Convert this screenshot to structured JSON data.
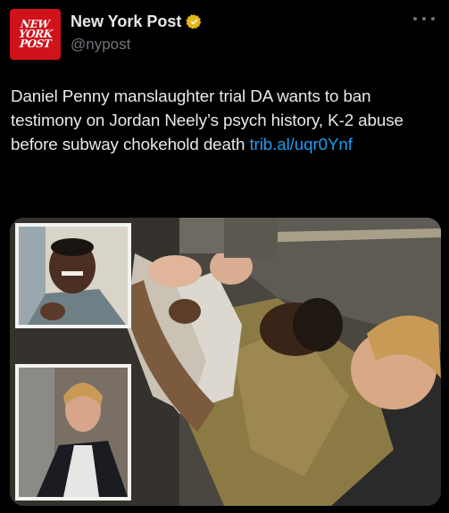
{
  "account": {
    "avatar_text": [
      "NEW",
      "YORK",
      "POST"
    ],
    "display_name": "New York Post",
    "handle": "@nypost",
    "verified_badge": "gold-verified-icon"
  },
  "tweet": {
    "text": "Daniel Penny manslaughter trial DA wants to ban testimony on Jordan Neely’s psych history, K-2 abuse before subway chokehold death",
    "link_text": "trib.al/uqr0Ynf"
  },
  "media": {
    "type": "photo-collage"
  },
  "colors": {
    "background": "#000000",
    "link": "#1d9bf0",
    "secondary_text": "#71767b",
    "brand_red": "#d0121b",
    "verified_gold": "#e2b719"
  }
}
